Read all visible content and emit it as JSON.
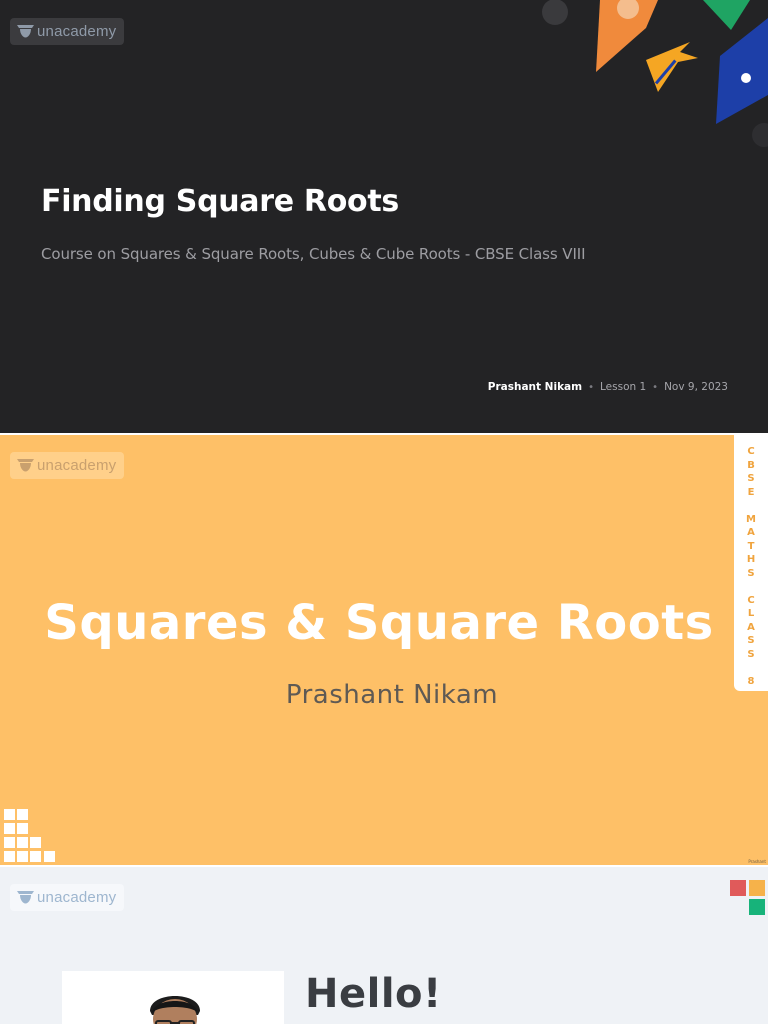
{
  "slides": [
    {
      "brand": "unacademy",
      "title": "Finding Square Roots",
      "subtitle": "Course on Squares & Square Roots, Cubes & Cube Roots - CBSE Class VIII",
      "meta": {
        "author": "Prashant Nikam",
        "lesson": "Lesson 1",
        "date": "Nov 9, 2023"
      },
      "colors": {
        "background": "#232325",
        "accent_orange": "#f08a3c",
        "accent_green": "#1fa463",
        "accent_blue": "#1d3fa8"
      }
    },
    {
      "brand": "unacademy",
      "title": "Squares & Square Roots",
      "presenter": "Prashant Nikam",
      "side_label": [
        "C",
        "B",
        "S",
        "E",
        "",
        "M",
        "A",
        "T",
        "H",
        "S",
        "",
        "C",
        "L",
        "A",
        "S",
        "S",
        "",
        "8"
      ],
      "corner_text": "Prashant",
      "colors": {
        "background": "#fec067",
        "side_text": "#f0a43e"
      }
    },
    {
      "brand": "unacademy",
      "greeting": "Hello!",
      "colors": {
        "background": "#eff2f6",
        "red": "#e05a5a",
        "orange": "#f6b24a",
        "green": "#17b37a"
      }
    }
  ]
}
